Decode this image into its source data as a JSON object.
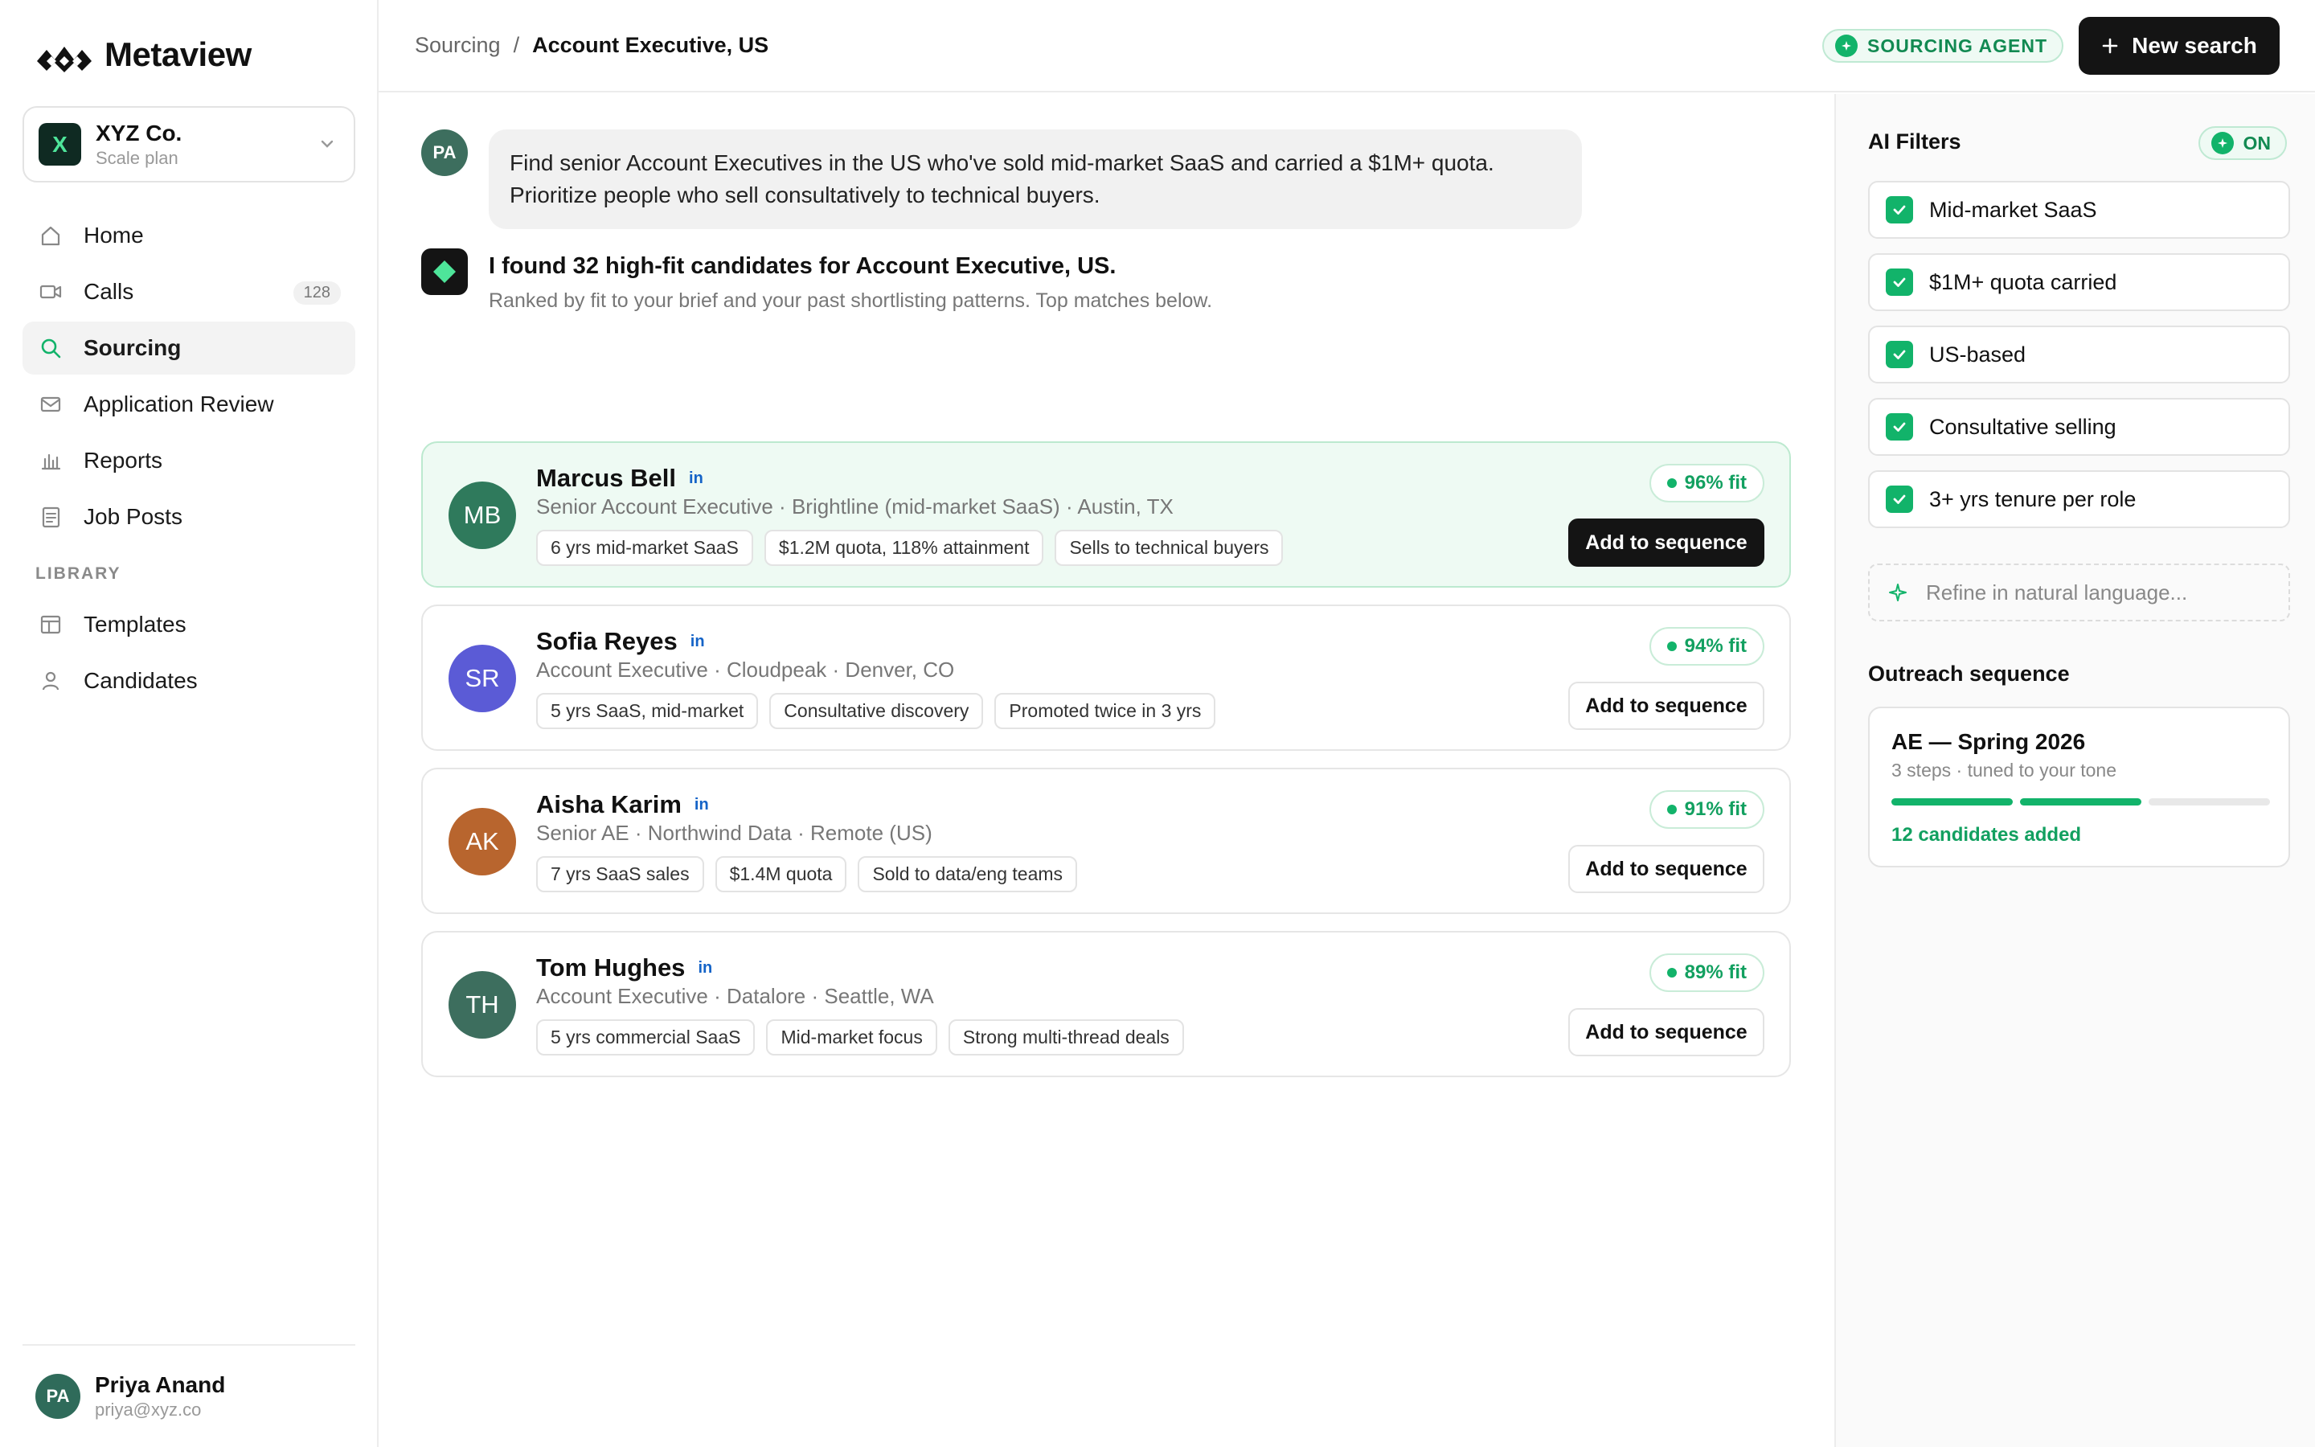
{
  "brand": {
    "name": "Metaview"
  },
  "org": {
    "initial": "X",
    "name": "XYZ Co.",
    "plan": "Scale plan"
  },
  "nav": {
    "items": [
      {
        "label": "Home",
        "icon": "home-icon"
      },
      {
        "label": "Calls",
        "icon": "video-icon",
        "count": "128"
      },
      {
        "label": "Sourcing",
        "icon": "search-icon",
        "active": true
      },
      {
        "label": "Application Review",
        "icon": "mail-icon"
      },
      {
        "label": "Reports",
        "icon": "bar-chart-icon"
      },
      {
        "label": "Job Posts",
        "icon": "document-icon"
      }
    ],
    "library_label": "LIBRARY",
    "library": [
      {
        "label": "Templates",
        "icon": "template-icon"
      },
      {
        "label": "Candidates",
        "icon": "person-icon"
      }
    ]
  },
  "user": {
    "initials": "PA",
    "name": "Priya Anand",
    "email": "priya@xyz.co"
  },
  "header": {
    "breadcrumb_root": "Sourcing",
    "breadcrumb_sep": "/",
    "breadcrumb_current": "Account Executive, US",
    "agent_label": "SOURCING AGENT",
    "new_search_label": "New search"
  },
  "chat": {
    "user_initials": "PA",
    "prompt": "Find senior Account Executives in the US who've sold mid-market SaaS and carried a $1M+ quota. Prioritize people who sell consultatively to technical buyers.",
    "answer_title": "I found 32 high-fit candidates for Account Executive, US.",
    "answer_sub": "Ranked by fit to your brief and your past shortlisting patterns. Top matches below."
  },
  "candidates": [
    {
      "initials": "MB",
      "name": "Marcus Bell",
      "li": "in",
      "meta": "Senior Account Executive · Brightline (mid-market SaaS) · Austin, TX",
      "tags": [
        "6 yrs mid-market SaaS",
        "$1.2M quota, 118% attainment",
        "Sells to technical buyers"
      ],
      "fit": "96% fit",
      "action": "Add to sequence",
      "avatar_color": "#2f7a5c",
      "highlight": true
    },
    {
      "initials": "SR",
      "name": "Sofia Reyes",
      "li": "in",
      "meta": "Account Executive · Cloudpeak · Denver, CO",
      "tags": [
        "5 yrs SaaS, mid-market",
        "Consultative discovery",
        "Promoted twice in 3 yrs"
      ],
      "fit": "94% fit",
      "action": "Add to sequence",
      "avatar_color": "#5b5bd6",
      "highlight": false
    },
    {
      "initials": "AK",
      "name": "Aisha Karim",
      "li": "in",
      "meta": "Senior AE · Northwind Data · Remote (US)",
      "tags": [
        "7 yrs SaaS sales",
        "$1.4M quota",
        "Sold to data/eng teams"
      ],
      "fit": "91% fit",
      "action": "Add to sequence",
      "avatar_color": "#b8652e",
      "highlight": false
    },
    {
      "initials": "TH",
      "name": "Tom Hughes",
      "li": "in",
      "meta": "Account Executive · Datalore · Seattle, WA",
      "tags": [
        "5 yrs commercial SaaS",
        "Mid-market focus",
        "Strong multi-thread deals"
      ],
      "fit": "89% fit",
      "action": "Add to sequence",
      "avatar_color": "#3d6e5e",
      "highlight": false
    }
  ],
  "filters": {
    "title": "AI Filters",
    "status": "ON",
    "items": [
      "Mid-market SaaS",
      "$1M+ quota carried",
      "US-based",
      "Consultative selling",
      "3+ yrs tenure per role"
    ],
    "refine_placeholder": "Refine in natural language..."
  },
  "outreach": {
    "title": "Outreach sequence",
    "name": "AE — Spring 2026",
    "sub": "3 steps · tuned to your tone",
    "steps_done": 2,
    "steps_total": 3,
    "added": "12 candidates added"
  },
  "colors": {
    "accent": "#12b36a",
    "dark": "#141414"
  }
}
